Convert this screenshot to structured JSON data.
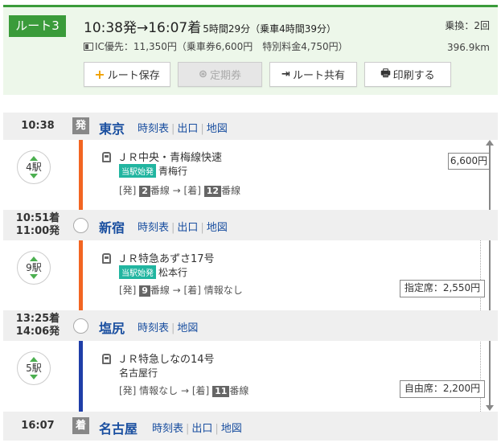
{
  "route": {
    "badge": "ルート3",
    "departure_arrival": "10:38発→16:07着",
    "duration": "5時間29分（乗車4時間39分）",
    "transfers": "乗換：2回",
    "fare": "IC優先：11,350円（乗車券6,600円　特別料金4,750円）",
    "distance": "396.9km"
  },
  "actions": {
    "save": "ルート保存",
    "commuter": "定期券",
    "share": "ルート共有",
    "print": "印刷する"
  },
  "stations": [
    {
      "time": "10:38",
      "mark": "発",
      "name": "東京",
      "links": [
        "時刻表",
        "出口",
        "地図"
      ]
    },
    {
      "time_arr": "10:51着",
      "time_dep": "11:00発",
      "name": "新宿",
      "links": [
        "時刻表",
        "出口",
        "地図"
      ]
    },
    {
      "time_arr": "13:25着",
      "time_dep": "14:06発",
      "name": "塩尻",
      "links": [
        "時刻表",
        "地図"
      ]
    },
    {
      "time": "16:07",
      "mark": "着",
      "name": "名古屋",
      "links": [
        "時刻表",
        "出口",
        "地図"
      ]
    }
  ],
  "segments": [
    {
      "stops": "4駅",
      "train": "ＪＲ中央・青梅線快速",
      "badge": "当駅始発",
      "dest": "青梅行",
      "track_dep_prefix": "[発]",
      "track_dep": "2",
      "track_dep_suffix": "番線 → ",
      "track_arr_prefix": "[着]",
      "track_arr": "12",
      "track_arr_suffix": "番線"
    },
    {
      "stops": "9駅",
      "train": "ＪＲ特急あずさ17号",
      "badge": "当駅始発",
      "dest": "松本行",
      "track_dep_prefix": "[発]",
      "track_dep": "9",
      "track_dep_suffix": "番線 → ",
      "track_arr_text": "[着] 情報なし",
      "fare": "指定席：2,550円"
    },
    {
      "stops": "5駅",
      "train": "ＪＲ特急しなの14号",
      "dest": "名古屋行",
      "track_dep_text": "[発] 情報なし → ",
      "track_arr_prefix": "[着]",
      "track_arr": "11",
      "track_arr_suffix": "番線",
      "fare": "自由席：2,200円"
    }
  ],
  "base_fare": "6,600円",
  "colors": {
    "green": "#3a9b3a",
    "line_orange": "#f26522",
    "line_blue": "#1f3ea8",
    "link_blue": "#1a4fa0"
  }
}
